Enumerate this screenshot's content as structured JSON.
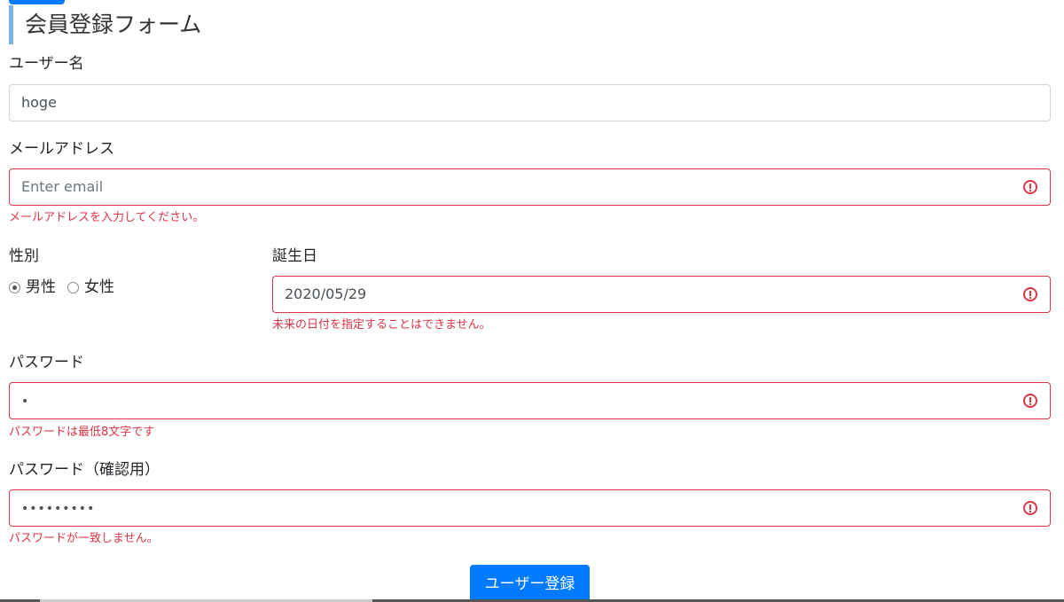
{
  "form": {
    "title": "会員登録フォーム",
    "username": {
      "label": "ユーザー名",
      "value": "hoge"
    },
    "email": {
      "label": "メールアドレス",
      "placeholder": "Enter email",
      "error": "メールアドレスを入力してください。"
    },
    "gender": {
      "label": "性別",
      "options": [
        "男性",
        "女性"
      ],
      "selected": "男性"
    },
    "birthday": {
      "label": "誕生日",
      "value": "2020/05/29",
      "error": "未来の日付を指定することはできません。"
    },
    "password": {
      "label": "パスワード",
      "value": "•",
      "error": "パスワードは最低8文字です"
    },
    "password_confirm": {
      "label": "パスワード（確認用）",
      "value": "•••••••••",
      "error": "パスワードが一致しません。"
    },
    "submit_label": "ユーザー登録"
  },
  "colors": {
    "primary": "#007bff",
    "error": "#dc3545",
    "title_accent": "#7ab3e0"
  }
}
